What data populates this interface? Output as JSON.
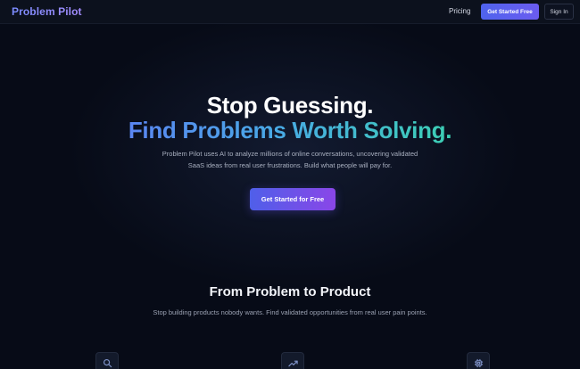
{
  "header": {
    "logo": "Problem Pilot",
    "nav_pricing": "Pricing",
    "get_started_label": "Get Started Free",
    "sign_in_label": "Sign In"
  },
  "hero": {
    "title_line1": "Stop Guessing.",
    "title_line2": "Find Problems Worth Solving.",
    "description": "Problem Pilot uses AI to analyze millions of online conversations, uncovering validated SaaS ideas from real user frustrations. Build what people will pay for.",
    "cta_label": "Get Started for Free"
  },
  "section": {
    "title": "From Problem to Product",
    "description": "Stop building products nobody wants. Find validated opportunities from real user pain points."
  },
  "features": [
    {
      "icon": "search-icon"
    },
    {
      "icon": "trending-up-icon"
    },
    {
      "icon": "cpu-chip-icon"
    }
  ],
  "colors": {
    "background": "#070b17",
    "accent": "#4f63ee",
    "gradient_teal": "#3ccfb4",
    "gradient_purple": "#8a46e8"
  }
}
